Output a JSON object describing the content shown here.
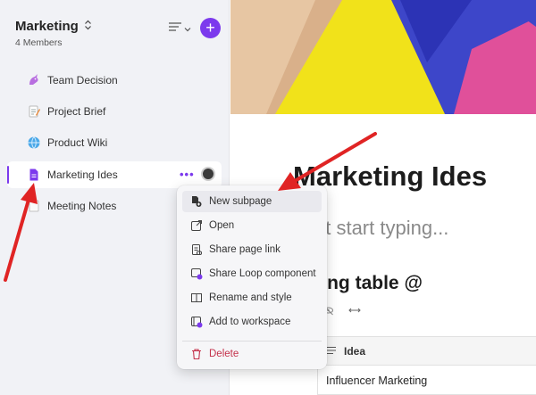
{
  "workspace": {
    "title": "Marketing",
    "members": "4 Members"
  },
  "sidebar": {
    "items": [
      {
        "label": "Team Decision",
        "icon": "unicorn-icon"
      },
      {
        "label": "Project Brief",
        "icon": "memo-icon"
      },
      {
        "label": "Product Wiki",
        "icon": "globe-icon"
      },
      {
        "label": "Marketing Ides",
        "icon": "document-icon",
        "active": true
      },
      {
        "label": "Meeting Notes",
        "icon": "page-icon"
      }
    ],
    "more_label": "•••"
  },
  "context_menu": {
    "items": [
      {
        "label": "New subpage",
        "icon": "new-subpage-icon"
      },
      {
        "label": "Open",
        "icon": "open-external-icon"
      },
      {
        "label": "Share page link",
        "icon": "share-link-icon"
      },
      {
        "label": "Share Loop component",
        "icon": "loop-component-icon"
      },
      {
        "label": "Rename and style",
        "icon": "rename-icon"
      },
      {
        "label": "Add to workspace",
        "icon": "add-workspace-icon"
      }
    ],
    "delete_label": "Delete"
  },
  "page": {
    "title": "Marketing Ides",
    "placeholder": "Just start typing...",
    "section_title": "Voting table @",
    "table": {
      "column": "Idea",
      "rows": [
        "Influencer Marketing"
      ]
    }
  },
  "colors": {
    "accent": "#7c3aed",
    "arrow": "#e02424",
    "danger": "#c4314b",
    "sidebar_bg": "#f1f2f6"
  }
}
